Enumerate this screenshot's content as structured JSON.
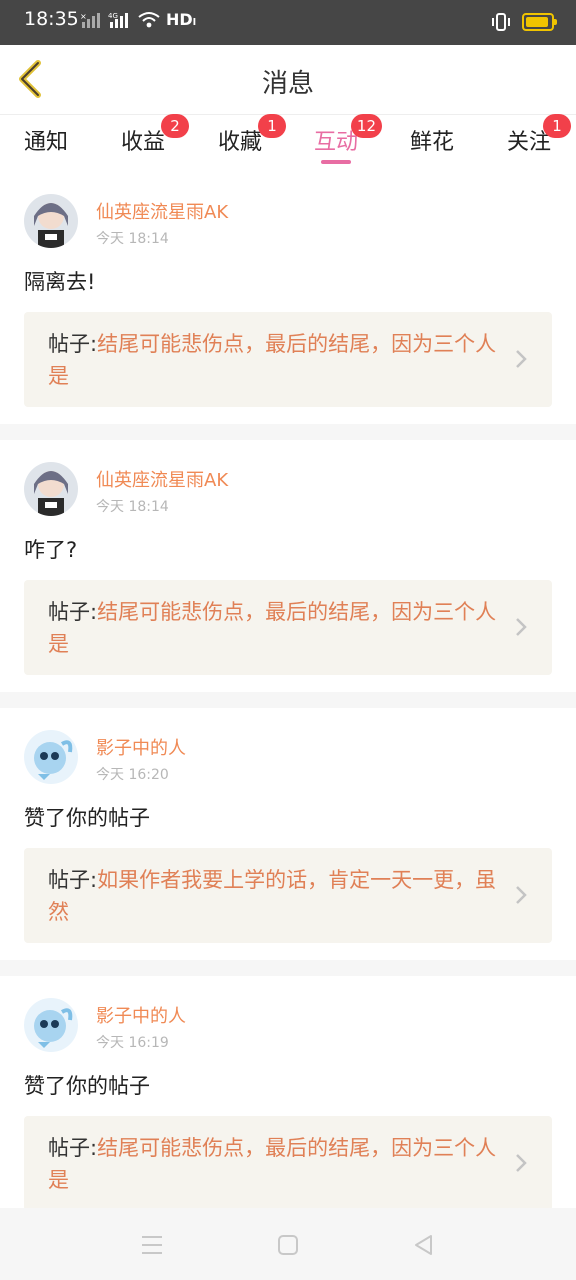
{
  "status": {
    "time": "18:35",
    "hd": "HDₗ"
  },
  "header": {
    "title": "消息"
  },
  "tabs": [
    {
      "label": "通知",
      "badge": ""
    },
    {
      "label": "收益",
      "badge": "2"
    },
    {
      "label": "收藏",
      "badge": "1"
    },
    {
      "label": "互动",
      "badge": "12",
      "active": true
    },
    {
      "label": "鲜花",
      "badge": ""
    },
    {
      "label": "关注",
      "badge": "1"
    }
  ],
  "items": [
    {
      "user": "仙英座流星雨AK",
      "time": "今天 18:14",
      "content": "隔离去!",
      "post_prefix": "帖子:",
      "post_title": "结尾可能悲伤点，最后的结尾，因为三个人是"
    },
    {
      "user": "仙英座流星雨AK",
      "time": "今天 18:14",
      "content": "咋了?",
      "post_prefix": "帖子:",
      "post_title": "结尾可能悲伤点，最后的结尾，因为三个人是"
    },
    {
      "user": "影子中的人",
      "time": "今天 16:20",
      "content": "赞了你的帖子",
      "post_prefix": "帖子:",
      "post_title": "如果作者我要上学的话，肯定一天一更，虽然"
    },
    {
      "user": "影子中的人",
      "time": "今天 16:19",
      "content": "赞了你的帖子",
      "post_prefix": "帖子:",
      "post_title": "结尾可能悲伤点，最后的结尾，因为三个人是"
    }
  ],
  "colors": {
    "accent": "#e86da3",
    "name": "#f08a55",
    "badge": "#f2404a",
    "post_bg": "#f6f4ee"
  }
}
